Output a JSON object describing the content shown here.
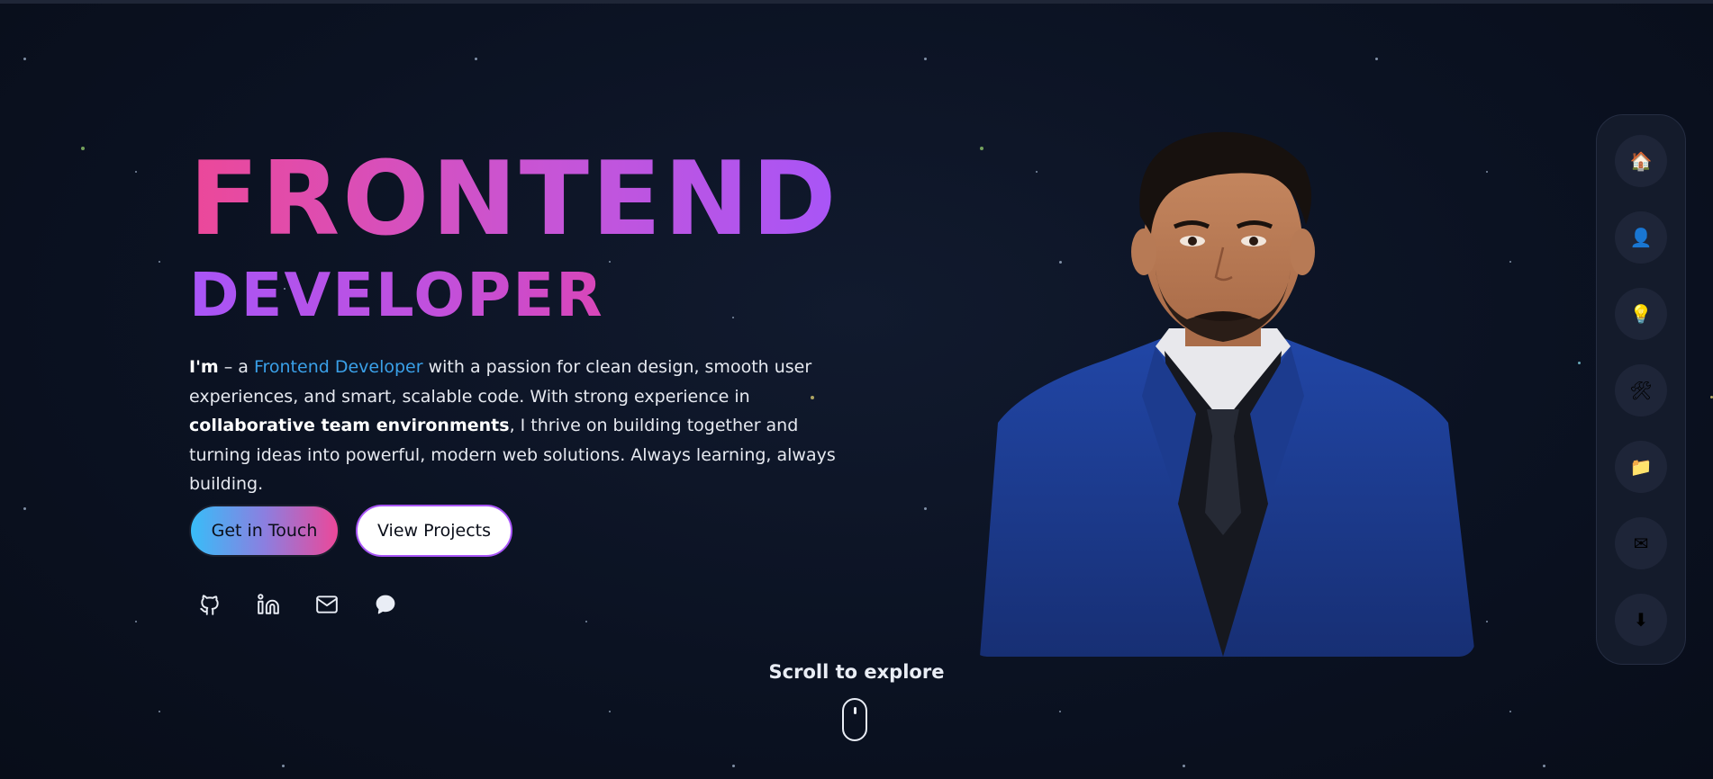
{
  "hero": {
    "title": "FRONTEND",
    "subtitle": "DEVELOPER",
    "intro": {
      "lead": "I'm",
      "dash_a": " – a ",
      "role": "Frontend Developer",
      "part1": " with a passion for clean design, smooth user experiences, and smart, scalable code. With strong experience in ",
      "emphasis": "collaborative team environments",
      "part2": ", I thrive on building together and turning ideas into powerful, modern web solutions. Always learning, always building."
    },
    "primary_button": "Get in Touch",
    "secondary_button": "View Projects"
  },
  "social_icons": [
    "github-icon",
    "linkedin-icon",
    "mail-icon",
    "chat-icon"
  ],
  "scroll_hint": "Scroll to explore",
  "side_nav": [
    {
      "icon": "home-icon",
      "glyph": "🏠"
    },
    {
      "icon": "user-icon",
      "glyph": "👤"
    },
    {
      "icon": "lightbulb-icon",
      "glyph": "💡"
    },
    {
      "icon": "tools-icon",
      "glyph": "🛠"
    },
    {
      "icon": "folder-icon",
      "glyph": "📁"
    },
    {
      "icon": "envelope-icon",
      "glyph": "✉"
    },
    {
      "icon": "download-icon",
      "glyph": "⬇"
    }
  ],
  "colors": {
    "background": "#0b1120",
    "gradient_pink": "#ec4899",
    "gradient_purple": "#a855f7",
    "accent_blue": "#3aa0e8",
    "button_cyan": "#38bdf8"
  }
}
